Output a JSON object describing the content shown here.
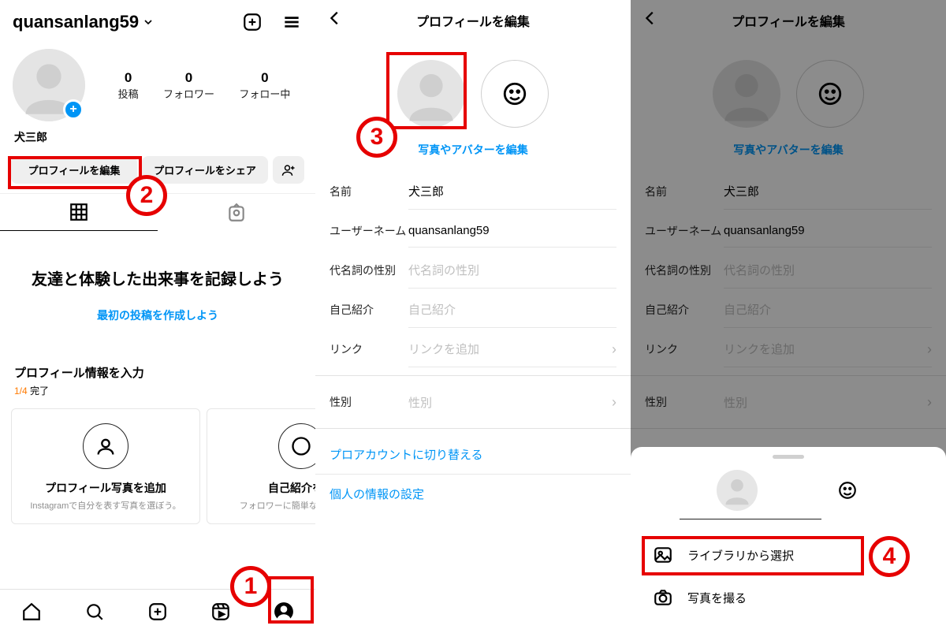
{
  "panel1": {
    "username": "quansanlang59",
    "stats": {
      "posts_n": "0",
      "posts_l": "投稿",
      "followers_n": "0",
      "followers_l": "フォロワー",
      "following_n": "0",
      "following_l": "フォロー中"
    },
    "display_name": "犬三郎",
    "btn_edit": "プロフィールを編集",
    "btn_share": "プロフィールをシェア",
    "empty_title": "友達と体験した出来事を記録しよう",
    "empty_link": "最初の投稿を作成しよう",
    "info_title": "プロフィール情報を入力",
    "info_done": "1/4",
    "info_done_suffix": " 完了",
    "card1_t": "プロフィール写真を追加",
    "card1_d": "Instagramで自分を表す写真を選ぼう。",
    "card2_t": "自己紹介を追",
    "card2_d": "フォロワーに簡単な自\nしよう。"
  },
  "edit": {
    "title": "プロフィールを編集",
    "avatar_link": "写真やアバターを編集",
    "f_name_l": "名前",
    "f_name_v": "犬三郎",
    "f_user_l": "ユーザーネーム",
    "f_user_v": "quansanlang59",
    "f_pronoun_l": "代名詞の性別",
    "f_pronoun_ph": "代名詞の性別",
    "f_bio_l": "自己紹介",
    "f_bio_ph": "自己紹介",
    "f_link_l": "リンク",
    "f_link_ph": "リンクを追加",
    "f_gender_l": "性別",
    "f_gender_ph": "性別",
    "switch_pro": "プロアカウントに切り替える",
    "personal_info": "個人の情報の設定"
  },
  "sheet": {
    "library": "ライブラリから選択",
    "camera": "写真を撮る"
  },
  "annotations": {
    "a1": "1",
    "a2": "2",
    "a3": "3",
    "a4": "4"
  }
}
